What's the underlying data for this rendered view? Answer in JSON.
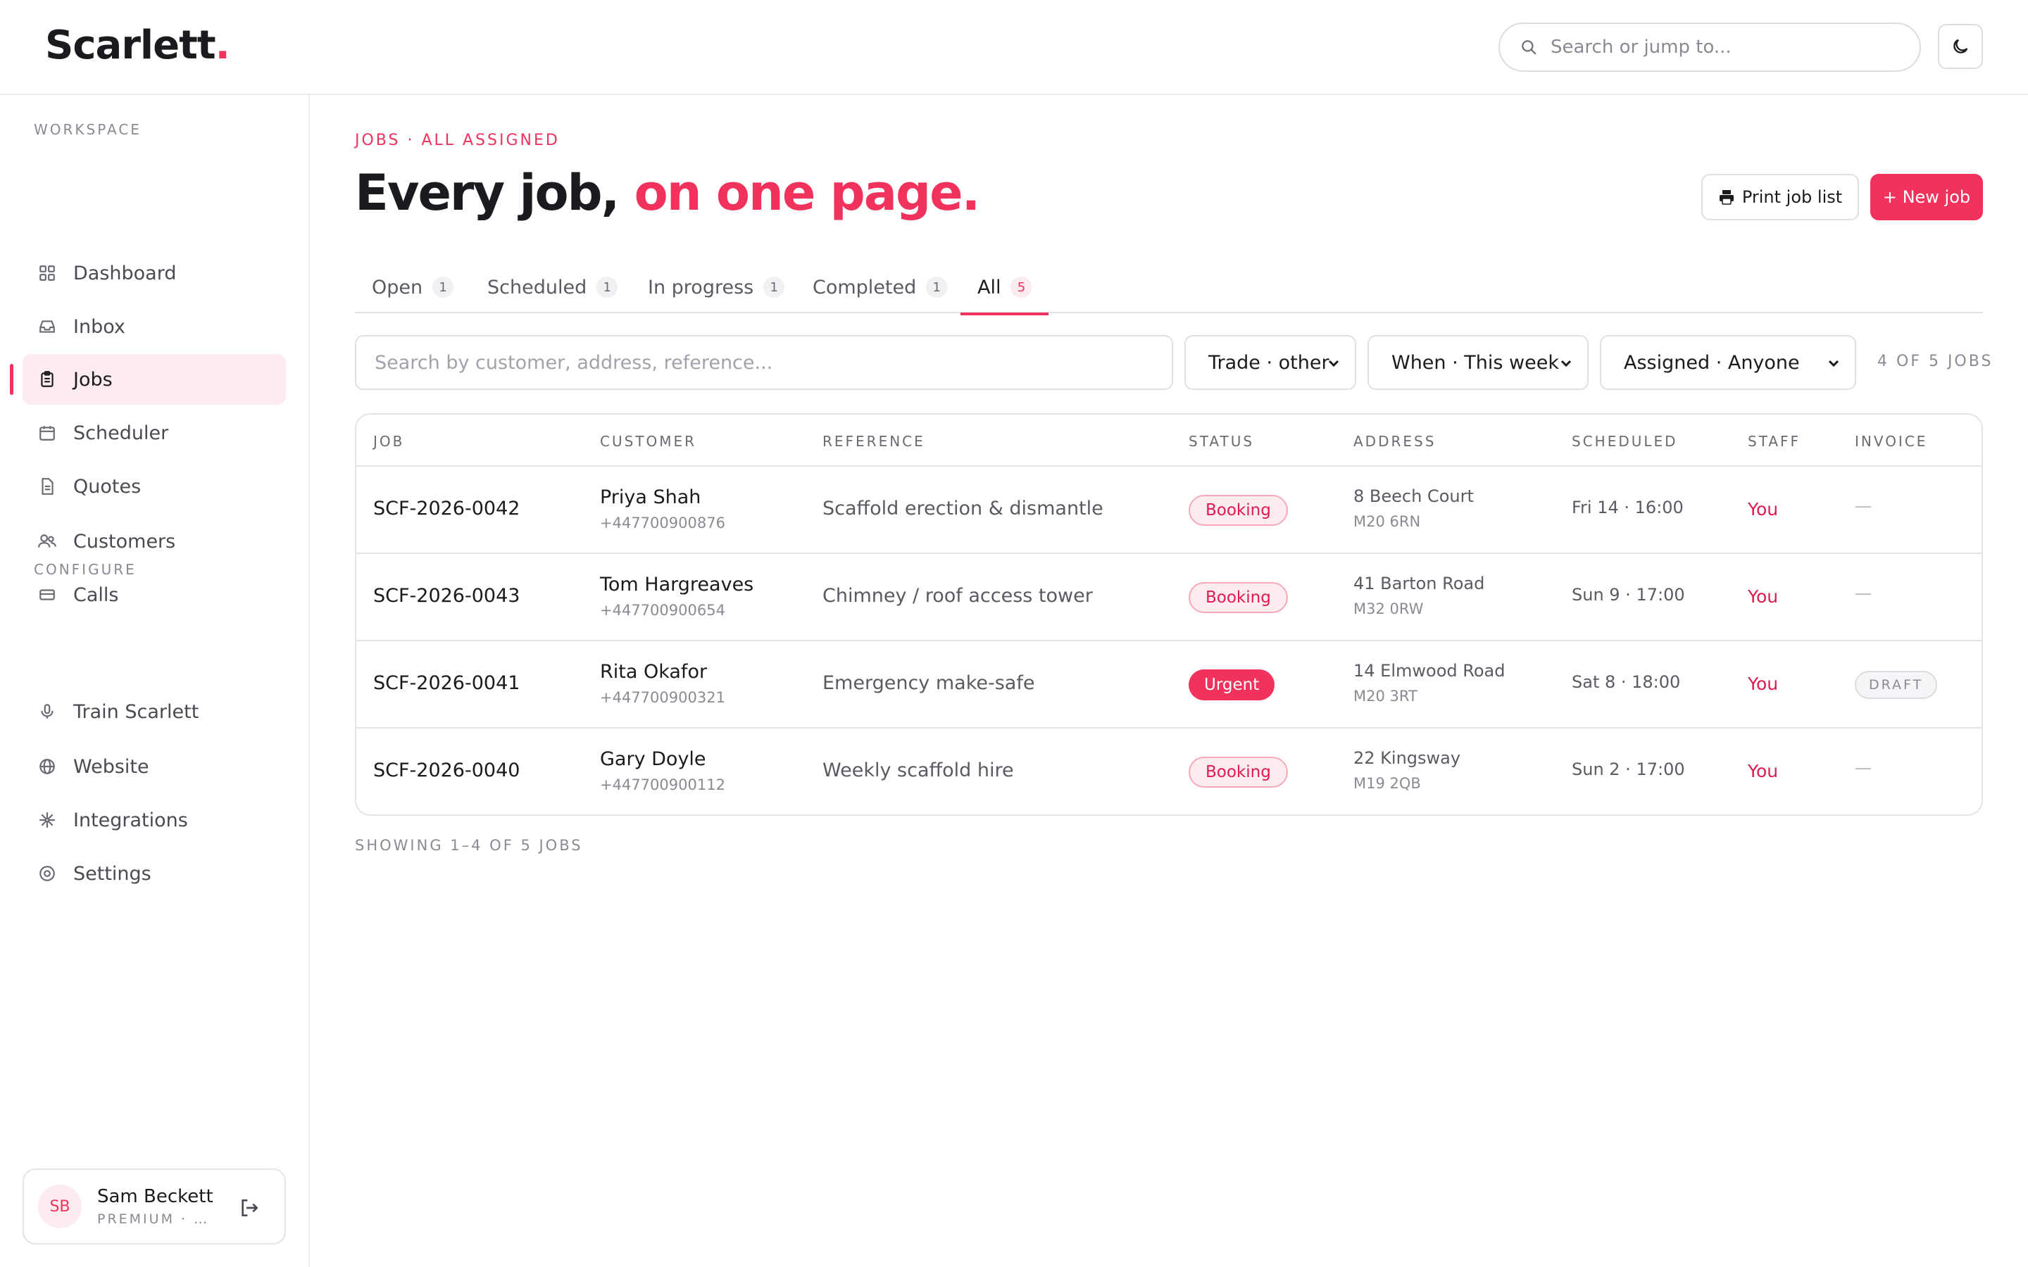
{
  "brand": {
    "name": "Scarlett",
    "dot": ".",
    "accent_color": "#f0325c"
  },
  "header": {
    "search_placeholder": "Search or jump to...",
    "search_icon": "search-icon",
    "theme_icon": "moon-icon"
  },
  "sidebar": {
    "workspace_label": "WORKSPACE",
    "configure_label": "CONFIGURE",
    "workspace_items": [
      {
        "label": "Dashboard",
        "icon": "grid-icon"
      },
      {
        "label": "Inbox",
        "icon": "inbox-icon"
      },
      {
        "label": "Jobs",
        "icon": "clipboard-icon",
        "active": true
      },
      {
        "label": "Scheduler",
        "icon": "calendar-icon"
      },
      {
        "label": "Quotes",
        "icon": "document-icon"
      },
      {
        "label": "Customers",
        "icon": "users-icon"
      },
      {
        "label": "Calls",
        "icon": "card-icon"
      }
    ],
    "configure_items": [
      {
        "label": "Train Scarlett",
        "icon": "microphone-icon"
      },
      {
        "label": "Website",
        "icon": "globe-icon"
      },
      {
        "label": "Integrations",
        "icon": "sparkle-icon"
      },
      {
        "label": "Settings",
        "icon": "settings-icon"
      }
    ],
    "user": {
      "initials": "SB",
      "name": "Sam Beckett",
      "plan": "PREMIUM · S..."
    }
  },
  "main": {
    "kicker": "JOBS · ALL ASSIGNED",
    "title_start": "Every job,",
    "title_accent": " on one page.",
    "print_label": "Print job list",
    "new_label": "+ New job",
    "tabs": [
      {
        "label": "Open",
        "count": "1"
      },
      {
        "label": "Scheduled",
        "count": "1"
      },
      {
        "label": "In progress",
        "count": "1"
      },
      {
        "label": "Completed",
        "count": "1"
      },
      {
        "label": "All",
        "count": "5",
        "active": true
      }
    ],
    "filters": {
      "search_placeholder": "Search by customer, address, reference...",
      "trade": "Trade · other",
      "when": "When · This week",
      "assigned": "Assigned · Anyone",
      "count": "4 OF 5 JOBS"
    },
    "table": {
      "headers": [
        "JOB",
        "CUSTOMER",
        "REFERENCE",
        "STATUS",
        "ADDRESS",
        "SCHEDULED",
        "STAFF",
        "INVOICE"
      ],
      "rows": [
        {
          "job": "SCF-2026-0042",
          "customer": "Priya Shah",
          "phone": "+447700900876",
          "reference": "Scaffold erection & dismantle",
          "status": "Booking",
          "address1": "8 Beech Court",
          "address2": "M20 6RN",
          "scheduled": "Fri 14 · 16:00",
          "staff": "You",
          "invoice": "—"
        },
        {
          "job": "SCF-2026-0043",
          "customer": "Tom Hargreaves",
          "phone": "+447700900654",
          "reference": "Chimney / roof access tower",
          "status": "Booking",
          "address1": "41 Barton Road",
          "address2": "M32 0RW",
          "scheduled": "Sun 9 · 17:00",
          "staff": "You",
          "invoice": "—"
        },
        {
          "job": "SCF-2026-0041",
          "customer": "Rita Okafor",
          "phone": "+447700900321",
          "reference": "Emergency make-safe",
          "status": "Urgent",
          "address1": "14 Elmwood Road",
          "address2": "M20 3RT",
          "scheduled": "Sat 8 · 18:00",
          "staff": "You",
          "invoice": "DRAFT"
        },
        {
          "job": "SCF-2026-0040",
          "customer": "Gary Doyle",
          "phone": "+447700900112",
          "reference": "Weekly scaffold hire",
          "status": "Booking",
          "address1": "22 Kingsway",
          "address2": "M19 2QB",
          "scheduled": "Sun 2 · 17:00",
          "staff": "You",
          "invoice": "—"
        }
      ]
    },
    "showing": "SHOWING 1–4 OF 5 JOBS"
  }
}
